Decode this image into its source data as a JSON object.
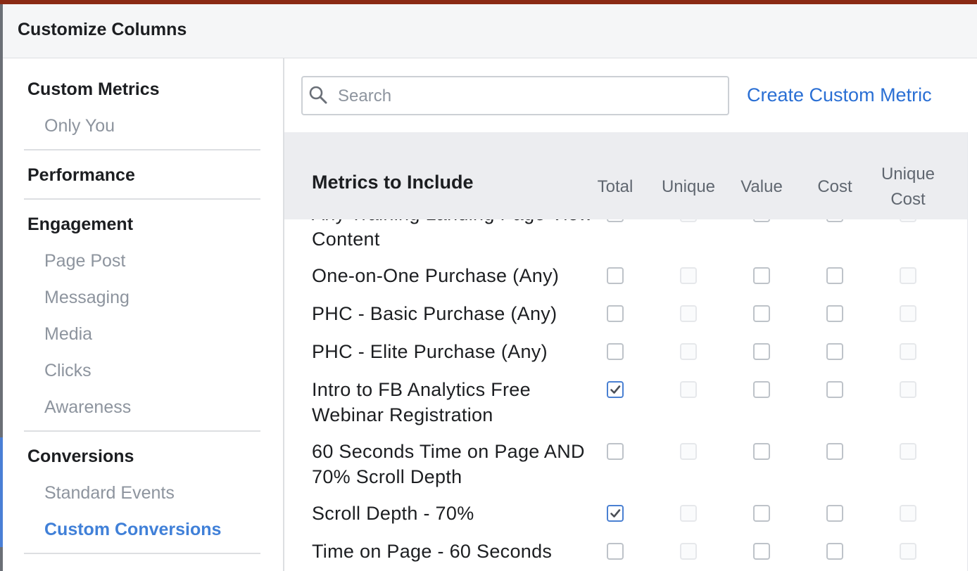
{
  "dialog": {
    "title": "Customize Columns"
  },
  "sidebar": {
    "sections": [
      {
        "title": "Custom Metrics",
        "items": [
          {
            "label": "Only You",
            "active": false
          }
        ]
      },
      {
        "title": "Performance",
        "items": []
      },
      {
        "title": "Engagement",
        "items": [
          {
            "label": "Page Post",
            "active": false
          },
          {
            "label": "Messaging",
            "active": false
          },
          {
            "label": "Media",
            "active": false
          },
          {
            "label": "Clicks",
            "active": false
          },
          {
            "label": "Awareness",
            "active": false
          }
        ]
      },
      {
        "title": "Conversions",
        "items": [
          {
            "label": "Standard Events",
            "active": false
          },
          {
            "label": "Custom Conversions",
            "active": true
          }
        ]
      }
    ]
  },
  "search": {
    "placeholder": "Search",
    "value": ""
  },
  "create_link": "Create Custom Metric",
  "table": {
    "title": "Metrics to Include",
    "columns": [
      "Total",
      "Unique",
      "Value",
      "Cost",
      "Unique Cost"
    ],
    "rows": [
      {
        "label": "Any Training Landing Page View Content",
        "checks": [
          false,
          null,
          false,
          false,
          null
        ]
      },
      {
        "label": "One-on-One Purchase (Any)",
        "checks": [
          false,
          null,
          false,
          false,
          null
        ]
      },
      {
        "label": "PHC - Basic Purchase (Any)",
        "checks": [
          false,
          null,
          false,
          false,
          null
        ]
      },
      {
        "label": "PHC - Elite Purchase (Any)",
        "checks": [
          false,
          null,
          false,
          false,
          null
        ]
      },
      {
        "label": "Intro to FB Analytics Free Webinar Registration",
        "checks": [
          true,
          null,
          false,
          false,
          null
        ]
      },
      {
        "label": "60 Seconds Time on Page AND 70% Scroll Depth",
        "checks": [
          false,
          null,
          false,
          false,
          null
        ]
      },
      {
        "label": "Scroll Depth - 70%",
        "checks": [
          true,
          null,
          false,
          false,
          null
        ]
      },
      {
        "label": "Time on Page - 60 Seconds",
        "checks": [
          false,
          null,
          false,
          false,
          null
        ]
      }
    ]
  },
  "colors": {
    "accent": "#2a6fd4",
    "active_item": "#4080d8",
    "muted": "#8d949e"
  }
}
